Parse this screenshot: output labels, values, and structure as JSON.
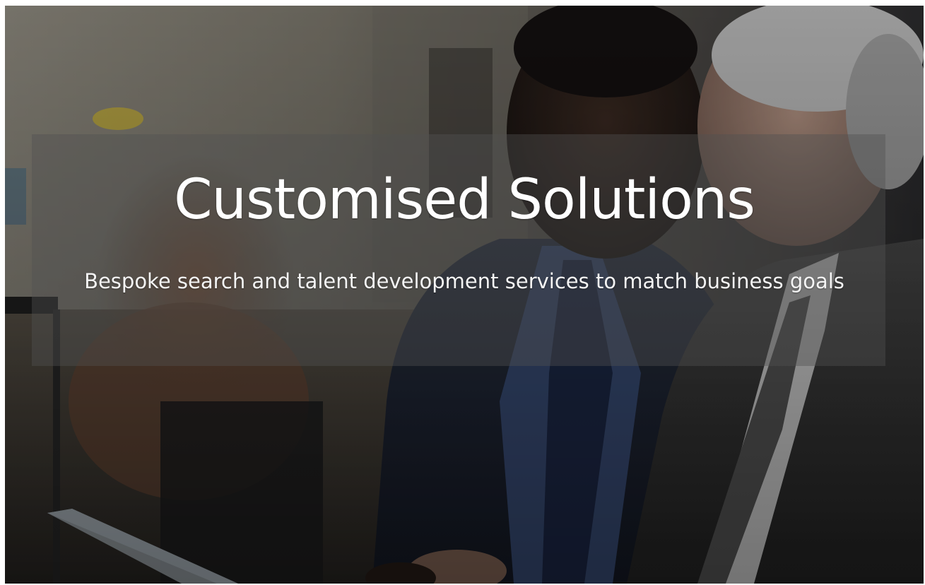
{
  "hero": {
    "title": "Customised Solutions",
    "subtitle": "Bespoke search and talent development services to match business goals",
    "background_image": "two-businessmen-looking-at-laptop-photo",
    "overlay_color": "#505050"
  }
}
